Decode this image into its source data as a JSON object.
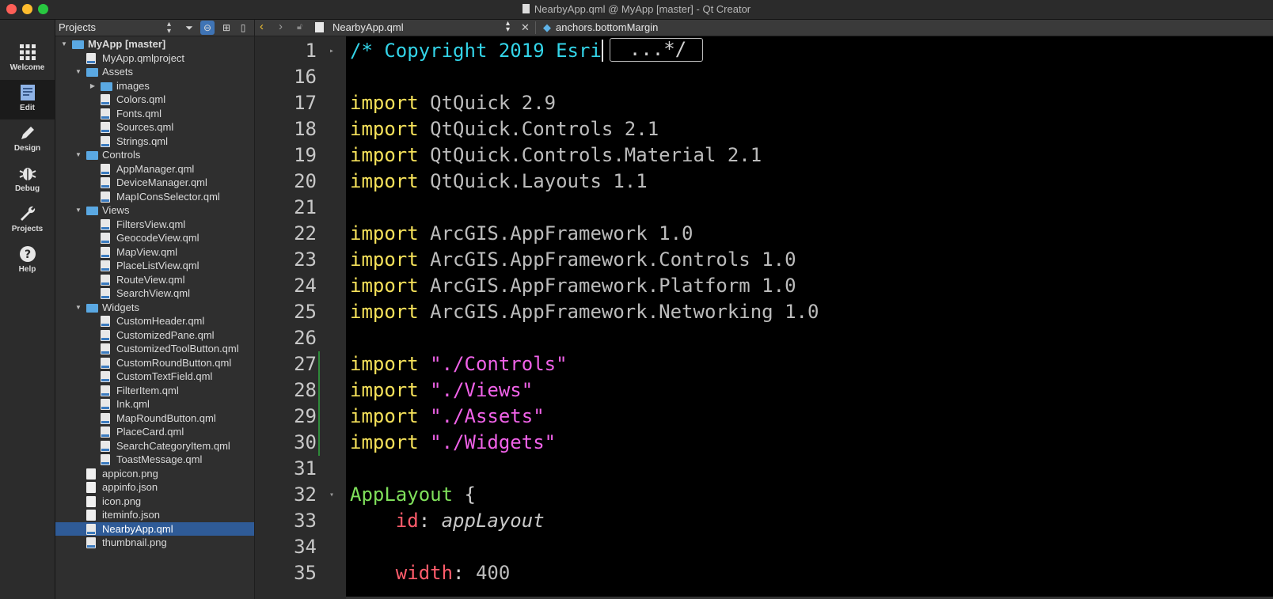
{
  "window": {
    "title": "NearbyApp.qml @ MyApp [master] - Qt Creator"
  },
  "modes": [
    {
      "label": "Welcome",
      "icon": "grid-icon"
    },
    {
      "label": "Edit",
      "icon": "edit-document-icon"
    },
    {
      "label": "Design",
      "icon": "pencil-icon"
    },
    {
      "label": "Debug",
      "icon": "bug-icon"
    },
    {
      "label": "Projects",
      "icon": "wrench-icon"
    },
    {
      "label": "Help",
      "icon": "help-icon"
    }
  ],
  "projects_pane": {
    "selector": "Projects",
    "tree": [
      {
        "label": "MyApp [master]",
        "level": 0,
        "kind": "project",
        "expanded": true,
        "bold": true
      },
      {
        "label": "MyApp.qmlproject",
        "level": 1,
        "kind": "qml"
      },
      {
        "label": "Assets",
        "level": 1,
        "kind": "folder",
        "expanded": true
      },
      {
        "label": "images",
        "level": 2,
        "kind": "folder",
        "expanded": false
      },
      {
        "label": "Colors.qml",
        "level": 2,
        "kind": "qml"
      },
      {
        "label": "Fonts.qml",
        "level": 2,
        "kind": "qml"
      },
      {
        "label": "Sources.qml",
        "level": 2,
        "kind": "qml"
      },
      {
        "label": "Strings.qml",
        "level": 2,
        "kind": "qml"
      },
      {
        "label": "Controls",
        "level": 1,
        "kind": "folder",
        "expanded": true
      },
      {
        "label": "AppManager.qml",
        "level": 2,
        "kind": "qml"
      },
      {
        "label": "DeviceManager.qml",
        "level": 2,
        "kind": "qml"
      },
      {
        "label": "MapIConsSelector.qml",
        "level": 2,
        "kind": "qml"
      },
      {
        "label": "Views",
        "level": 1,
        "kind": "folder",
        "expanded": true
      },
      {
        "label": "FiltersView.qml",
        "level": 2,
        "kind": "qml"
      },
      {
        "label": "GeocodeView.qml",
        "level": 2,
        "kind": "qml"
      },
      {
        "label": "MapView.qml",
        "level": 2,
        "kind": "qml"
      },
      {
        "label": "PlaceListView.qml",
        "level": 2,
        "kind": "qml"
      },
      {
        "label": "RouteView.qml",
        "level": 2,
        "kind": "qml"
      },
      {
        "label": "SearchView.qml",
        "level": 2,
        "kind": "qml"
      },
      {
        "label": "Widgets",
        "level": 1,
        "kind": "folder",
        "expanded": true
      },
      {
        "label": "CustomHeader.qml",
        "level": 2,
        "kind": "qml"
      },
      {
        "label": "CustomizedPane.qml",
        "level": 2,
        "kind": "qml"
      },
      {
        "label": "CustomizedToolButton.qml",
        "level": 2,
        "kind": "qml"
      },
      {
        "label": "CustomRoundButton.qml",
        "level": 2,
        "kind": "qml"
      },
      {
        "label": "CustomTextField.qml",
        "level": 2,
        "kind": "qml"
      },
      {
        "label": "FilterItem.qml",
        "level": 2,
        "kind": "qml"
      },
      {
        "label": "Ink.qml",
        "level": 2,
        "kind": "qml"
      },
      {
        "label": "MapRoundButton.qml",
        "level": 2,
        "kind": "qml"
      },
      {
        "label": "PlaceCard.qml",
        "level": 2,
        "kind": "qml"
      },
      {
        "label": "SearchCategoryItem.qml",
        "level": 2,
        "kind": "qml"
      },
      {
        "label": "ToastMessage.qml",
        "level": 2,
        "kind": "qml"
      },
      {
        "label": "appicon.png",
        "level": 1,
        "kind": "file"
      },
      {
        "label": "appinfo.json",
        "level": 1,
        "kind": "file"
      },
      {
        "label": "icon.png",
        "level": 1,
        "kind": "file"
      },
      {
        "label": "iteminfo.json",
        "level": 1,
        "kind": "file"
      },
      {
        "label": "NearbyApp.qml",
        "level": 1,
        "kind": "qml",
        "selected": true
      },
      {
        "label": "thumbnail.png",
        "level": 1,
        "kind": "qml"
      }
    ]
  },
  "editor_toolbar": {
    "file": "NearbyApp.qml",
    "symbol": "anchors.bottomMargin"
  },
  "editor": {
    "lines": [
      {
        "num": "1",
        "fold": "▸",
        "tokens": [
          {
            "t": "/* Copyright 2019 Esri",
            "c": "cmt"
          }
        ],
        "folded_box": "...*/",
        "cursor": true
      },
      {
        "num": "16",
        "tokens": []
      },
      {
        "num": "17",
        "tokens": [
          {
            "t": "import ",
            "c": "kw"
          },
          {
            "t": "QtQuick 2.9",
            "c": "mod"
          }
        ]
      },
      {
        "num": "18",
        "tokens": [
          {
            "t": "import ",
            "c": "kw"
          },
          {
            "t": "QtQuick.Controls 2.1",
            "c": "mod"
          }
        ]
      },
      {
        "num": "19",
        "tokens": [
          {
            "t": "import ",
            "c": "kw"
          },
          {
            "t": "QtQuick.Controls.Material 2.1",
            "c": "mod"
          }
        ]
      },
      {
        "num": "20",
        "tokens": [
          {
            "t": "import ",
            "c": "kw"
          },
          {
            "t": "QtQuick.Layouts 1.1",
            "c": "mod"
          }
        ]
      },
      {
        "num": "21",
        "tokens": []
      },
      {
        "num": "22",
        "tokens": [
          {
            "t": "import ",
            "c": "kw"
          },
          {
            "t": "ArcGIS.AppFramework 1.0",
            "c": "mod"
          }
        ]
      },
      {
        "num": "23",
        "tokens": [
          {
            "t": "import ",
            "c": "kw"
          },
          {
            "t": "ArcGIS.AppFramework.Controls 1.0",
            "c": "mod"
          }
        ]
      },
      {
        "num": "24",
        "tokens": [
          {
            "t": "import ",
            "c": "kw"
          },
          {
            "t": "ArcGIS.AppFramework.Platform 1.0",
            "c": "mod"
          }
        ]
      },
      {
        "num": "25",
        "tokens": [
          {
            "t": "import ",
            "c": "kw"
          },
          {
            "t": "ArcGIS.AppFramework.Networking 1.0",
            "c": "mod"
          }
        ]
      },
      {
        "num": "26",
        "tokens": []
      },
      {
        "num": "27",
        "changed": true,
        "tokens": [
          {
            "t": "import ",
            "c": "kw"
          },
          {
            "t": "\"./Controls\"",
            "c": "str"
          }
        ]
      },
      {
        "num": "28",
        "changed": true,
        "tokens": [
          {
            "t": "import ",
            "c": "kw"
          },
          {
            "t": "\"./Views\"",
            "c": "str"
          }
        ]
      },
      {
        "num": "29",
        "changed": true,
        "tokens": [
          {
            "t": "import ",
            "c": "kw"
          },
          {
            "t": "\"./Assets\"",
            "c": "str"
          }
        ]
      },
      {
        "num": "30",
        "changed": true,
        "tokens": [
          {
            "t": "import ",
            "c": "kw"
          },
          {
            "t": "\"./Widgets\"",
            "c": "str"
          }
        ]
      },
      {
        "num": "31",
        "tokens": []
      },
      {
        "num": "32",
        "fold": "▾",
        "tokens": [
          {
            "t": "AppLayout",
            "c": "type"
          },
          {
            "t": " {",
            "c": "punc"
          }
        ]
      },
      {
        "num": "33",
        "tokens": [
          {
            "t": "    ",
            "c": "punc"
          },
          {
            "t": "id",
            "c": "prop"
          },
          {
            "t": ": ",
            "c": "punc"
          },
          {
            "t": "appLayout",
            "c": "ital"
          }
        ]
      },
      {
        "num": "34",
        "tokens": []
      },
      {
        "num": "35",
        "tokens": [
          {
            "t": "    ",
            "c": "punc"
          },
          {
            "t": "width",
            "c": "prop"
          },
          {
            "t": ": ",
            "c": "punc"
          },
          {
            "t": "400",
            "c": "mod"
          }
        ]
      }
    ]
  }
}
